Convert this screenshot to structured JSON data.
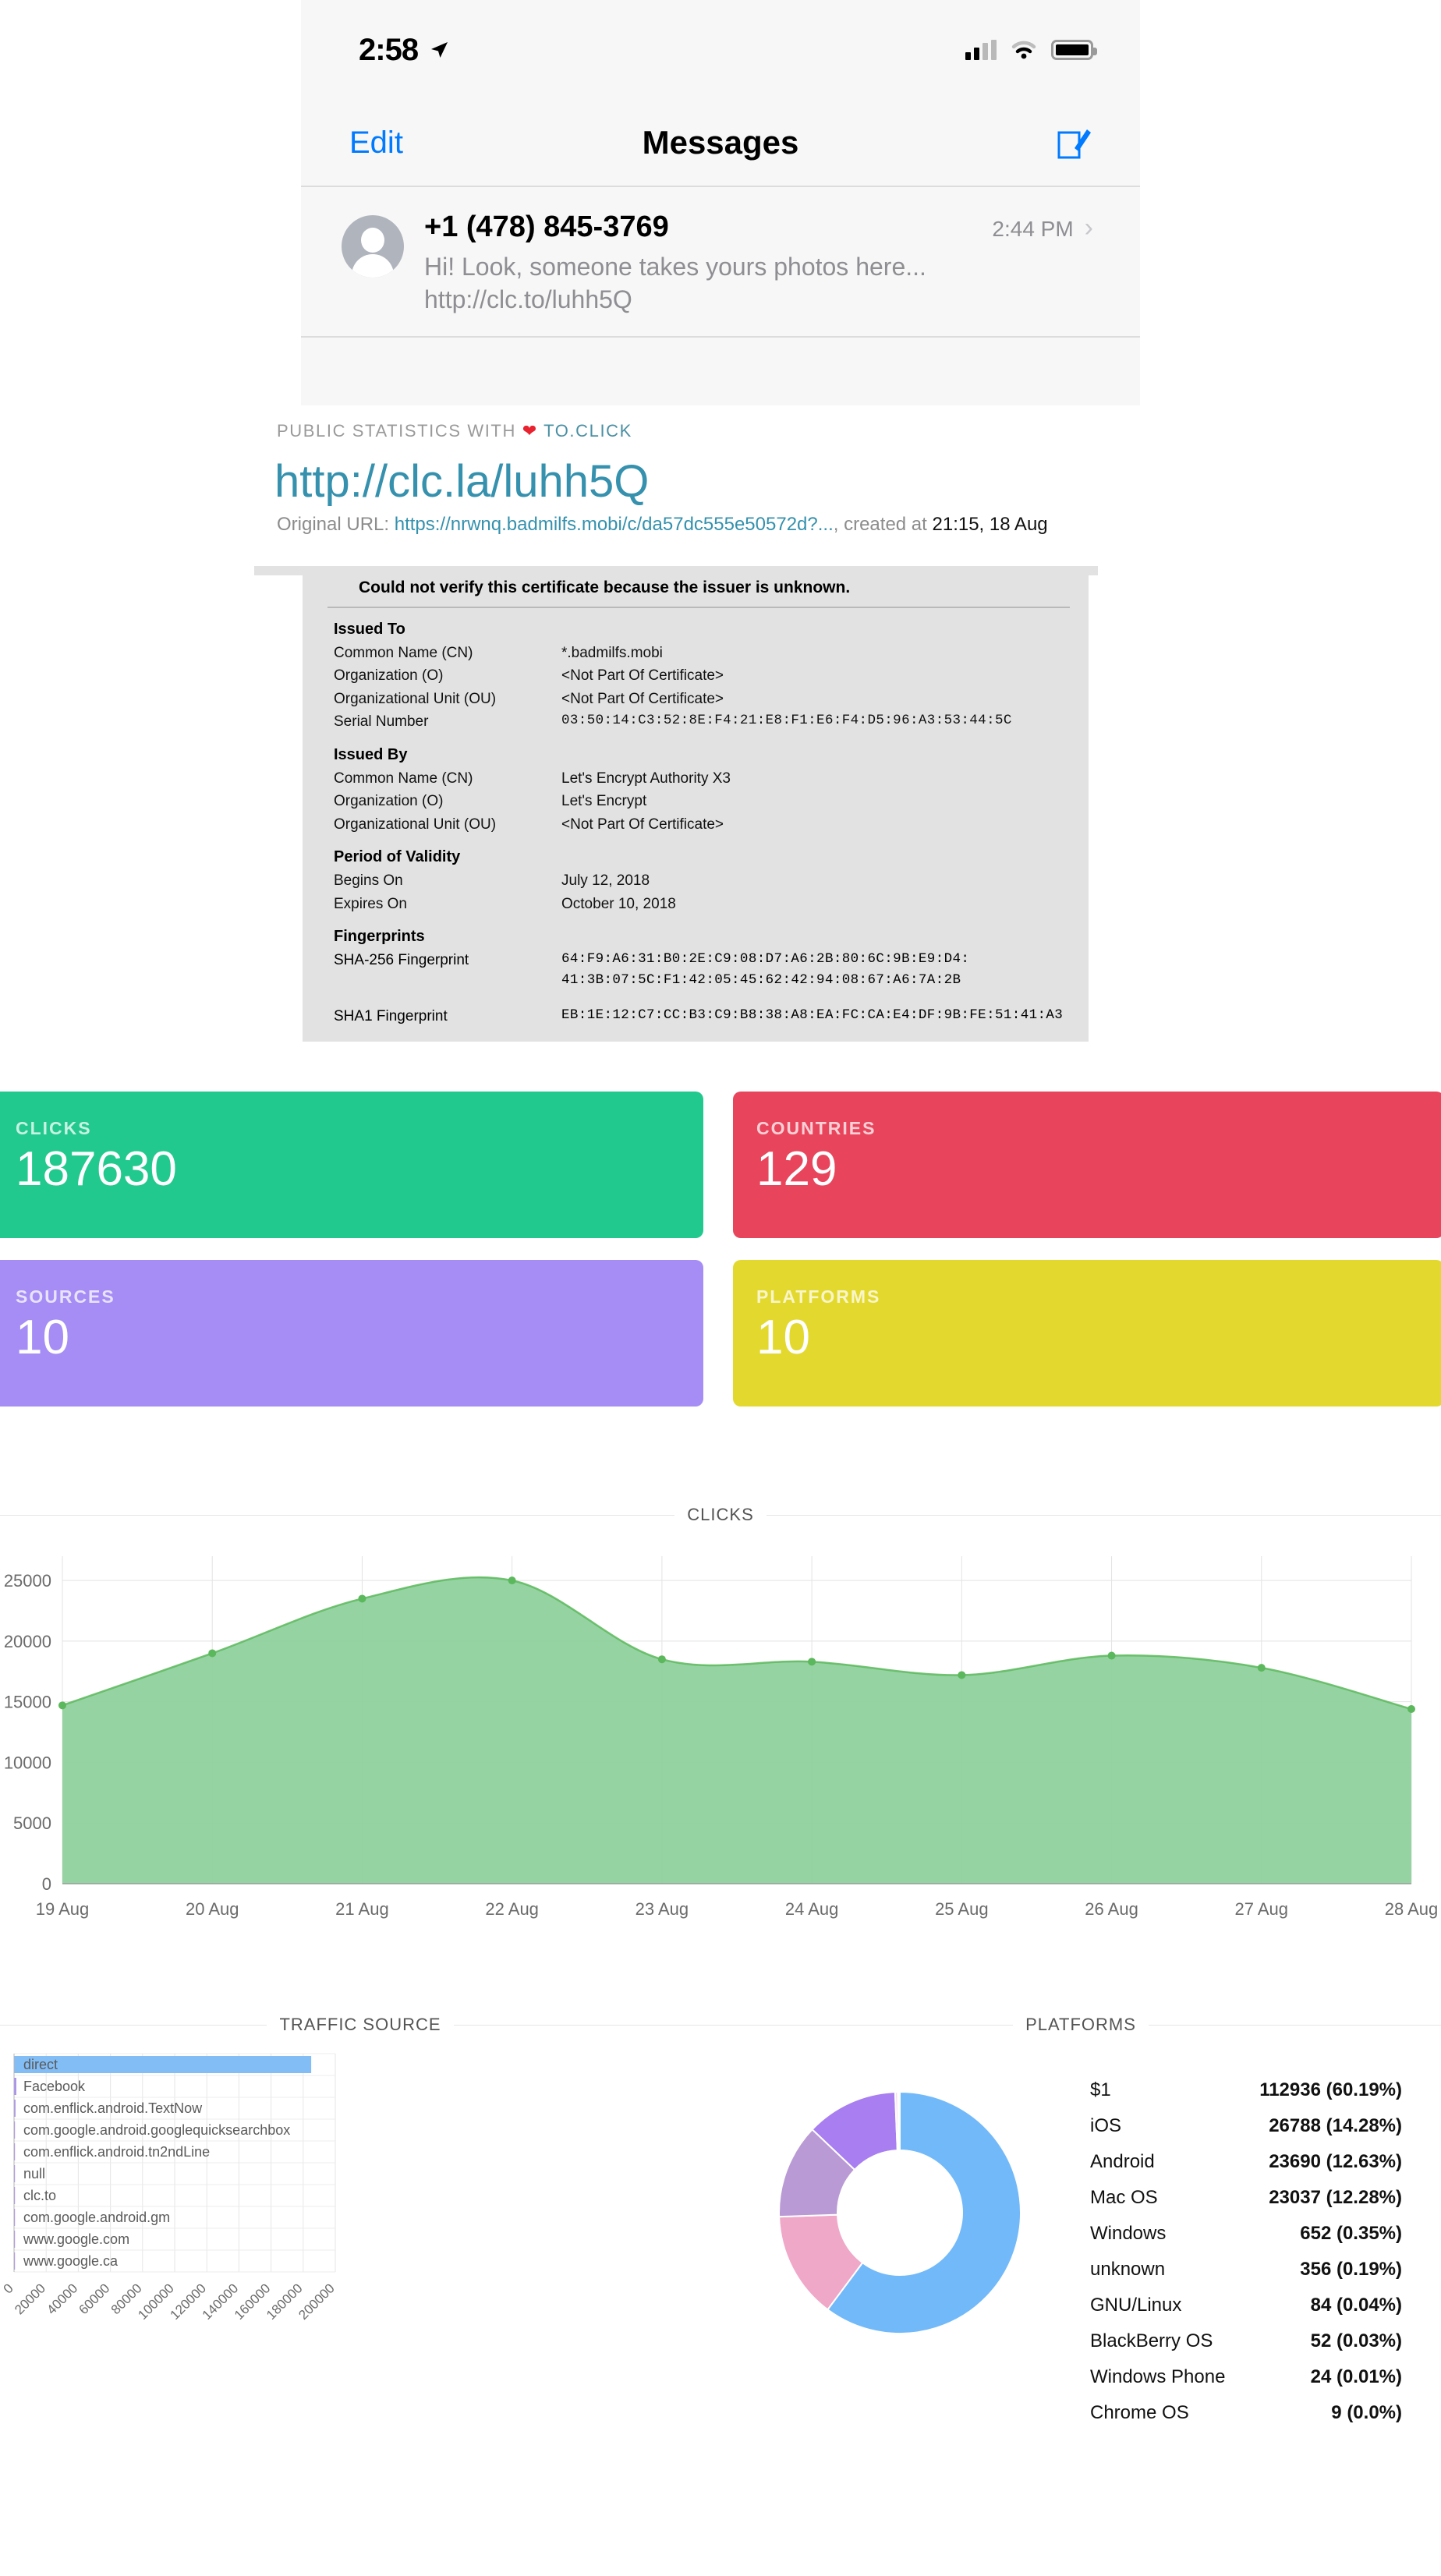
{
  "phone": {
    "status": {
      "time": "2:58",
      "location_icon": "location-arrow-icon",
      "signal_icon": "cellular-signal-icon",
      "wifi_icon": "wifi-icon",
      "battery_icon": "battery-icon"
    },
    "nav": {
      "edit_label": "Edit",
      "title": "Messages",
      "compose_icon": "compose-icon"
    },
    "message": {
      "sender": "+1 (478) 845-3769",
      "time": "2:44 PM",
      "preview": "Hi! Look, someone takes yours photos here... http://clc.to/luhh5Q",
      "avatar_icon": "person-avatar-icon",
      "chevron_icon": "chevron-right-icon"
    }
  },
  "stats_header": {
    "public_prefix": "PUBLIC STATISTICS WITH",
    "heart_icon": "heart-icon",
    "brand": "TO.CLICK",
    "short_url": "http://clc.la/luhh5Q",
    "original_label": "Original URL:",
    "original_url": "https://nrwnq.badmilfs.mobi/c/da57dc555e50572d?...",
    "created_label": ", created at",
    "created_at": "21:15, 18 Aug"
  },
  "certificate": {
    "warning": "Could not verify this certificate because the issuer is unknown.",
    "sections": [
      {
        "heading": "Issued To",
        "rows": [
          {
            "key": "Common Name (CN)",
            "value": "*.badmilfs.mobi",
            "highlight": true
          },
          {
            "key": "Organization (O)",
            "value": "<Not Part Of Certificate>"
          },
          {
            "key": "Organizational Unit (OU)",
            "value": "<Not Part Of Certificate>"
          },
          {
            "key": "Serial Number",
            "value": "03:50:14:C3:52:8E:F4:21:E8:F1:E6:F4:D5:96:A3:53:44:5C",
            "mono": true
          }
        ]
      },
      {
        "heading": "Issued By",
        "rows": [
          {
            "key": "Common Name (CN)",
            "value": "Let's Encrypt Authority X3"
          },
          {
            "key": "Organization (O)",
            "value": "Let's Encrypt"
          },
          {
            "key": "Organizational Unit (OU)",
            "value": "<Not Part Of Certificate>"
          }
        ]
      },
      {
        "heading": "Period of Validity",
        "rows": [
          {
            "key": "Begins On",
            "value": "July 12, 2018"
          },
          {
            "key": "Expires On",
            "value": "October 10, 2018"
          }
        ]
      }
    ],
    "fingerprints_heading": "Fingerprints",
    "sha256_key": "SHA-256 Fingerprint",
    "sha256_line1": "64:F9:A6:31:B0:2E:C9:08:D7:A6:2B:80:6C:9B:E9:D4:",
    "sha256_line2": "41:3B:07:5C:F1:42:05:45:62:42:94:08:67:A6:7A:2B",
    "sha1_key": "SHA1 Fingerprint",
    "sha1_value": "EB:1E:12:C7:CC:B3:C9:B8:38:A8:EA:FC:CA:E4:DF:9B:FE:51:41:A3"
  },
  "kpi": {
    "clicks": {
      "label": "CLICKS",
      "value": "187630",
      "color": "#22c98e"
    },
    "countries": {
      "label": "COUNTRIES",
      "value": "129",
      "color": "#e8455c"
    },
    "sources": {
      "label": "SOURCES",
      "value": "10",
      "color": "#a58df5"
    },
    "platforms": {
      "label": "PLATFORMS",
      "value": "10",
      "color": "#e3d92e"
    }
  },
  "chart_data": [
    {
      "type": "area",
      "title": "CLICKS",
      "xlabel": "",
      "ylabel": "",
      "grid": true,
      "legend": "none",
      "categories": [
        "19 Aug",
        "20 Aug",
        "21 Aug",
        "22 Aug",
        "23 Aug",
        "24 Aug",
        "25 Aug",
        "26 Aug",
        "27 Aug",
        "28 Aug"
      ],
      "values": [
        14700,
        19000,
        23500,
        25000,
        18500,
        18300,
        17200,
        18800,
        17800,
        14400
      ],
      "ylim": [
        0,
        27000
      ],
      "yticks": [
        0,
        5000,
        10000,
        15000,
        20000,
        25000
      ],
      "ytick_labels": [
        "0",
        "5000",
        "10000",
        "15000",
        "20000",
        "25000"
      ],
      "line_color": "#5cb85c",
      "fill_color": "#8fd19e"
    },
    {
      "type": "bar",
      "title": "TRAFFIC SOURCE",
      "orientation": "horizontal",
      "grid": true,
      "legend": "none",
      "categories": [
        "direct",
        "Facebook",
        "com.enflick.android.TextNow",
        "com.google.android.googlequicksearchbox",
        "com.enflick.android.tn2ndLine",
        "null",
        "clc.to",
        "com.google.android.gm",
        "www.google.com",
        "www.google.ca"
      ],
      "values": [
        185000,
        1400,
        900,
        280,
        180,
        140,
        110,
        70,
        50,
        30
      ],
      "xlim": [
        0,
        200000
      ],
      "xticks": [
        0,
        20000,
        40000,
        60000,
        80000,
        100000,
        120000,
        140000,
        160000,
        180000,
        200000
      ],
      "xtick_labels": [
        "0",
        "20000",
        "40000",
        "60000",
        "80000",
        "100000",
        "120000",
        "140000",
        "160000",
        "180000",
        "200000"
      ],
      "bar_color": "#82bdf6",
      "bar_color_alt": "#a98df0"
    },
    {
      "type": "pie",
      "title": "PLATFORMS",
      "donut": true,
      "legend": "right",
      "labels": [
        "$1",
        "iOS",
        "Android",
        "Mac OS",
        "Windows",
        "unknown",
        "GNU/Linux",
        "BlackBerry OS",
        "Windows Phone",
        "Chrome OS"
      ],
      "values": [
        112936,
        26788,
        23690,
        23037,
        652,
        356,
        84,
        52,
        24,
        9
      ],
      "percents": [
        "60.19%",
        "14.28%",
        "12.63%",
        "12.28%",
        "0.35%",
        "0.19%",
        "0.04%",
        "0.03%",
        "0.01%",
        "0.0%"
      ],
      "display_values": [
        "112936 (60.19%)",
        "26788 (14.28%)",
        "23690 (12.63%)",
        "23037 (12.28%)",
        "652 (0.35%)",
        "356 (0.19%)",
        "84 (0.04%)",
        "52 (0.03%)",
        "24 (0.01%)",
        "9 (0.0%)"
      ],
      "colors": [
        "#72b9fa",
        "#f0a8c8",
        "#b99ad4",
        "#a87ef0",
        "#f7d9e8",
        "#f9e4ef",
        "#fbecf4",
        "#fcf1f7",
        "#fdf5f9",
        "#fefafb"
      ]
    }
  ]
}
